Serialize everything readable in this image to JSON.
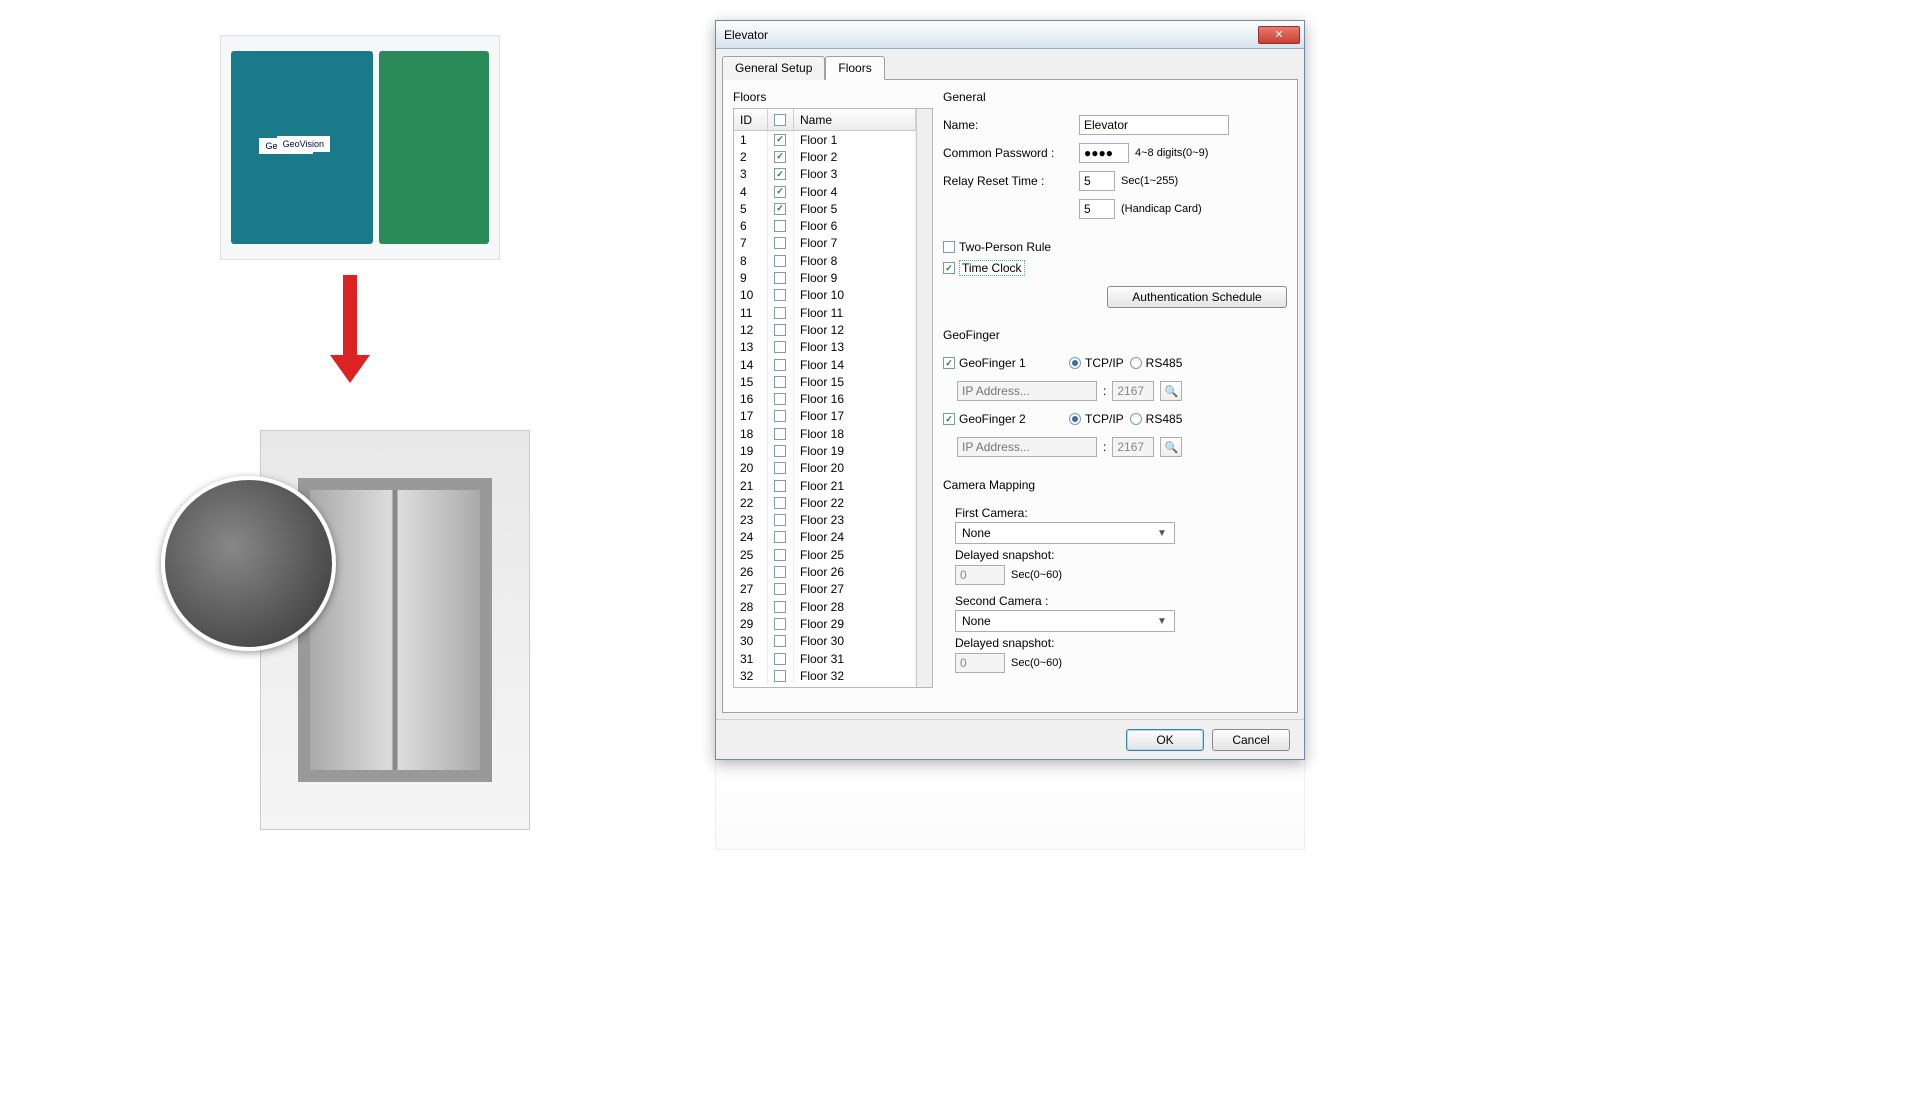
{
  "window": {
    "title": "Elevator",
    "close_glyph": "✕",
    "tabs": {
      "general_setup": "General Setup",
      "floors": "Floors"
    },
    "active_tab": "Floors"
  },
  "floors_panel": {
    "group_label": "Floors",
    "cols": {
      "id": "ID",
      "name": "Name"
    },
    "rows": [
      {
        "id": "1",
        "name": "Floor 1",
        "checked": true
      },
      {
        "id": "2",
        "name": "Floor 2",
        "checked": true
      },
      {
        "id": "3",
        "name": "Floor 3",
        "checked": true
      },
      {
        "id": "4",
        "name": "Floor 4",
        "checked": true
      },
      {
        "id": "5",
        "name": "Floor 5",
        "checked": true
      },
      {
        "id": "6",
        "name": "Floor 6",
        "checked": false
      },
      {
        "id": "7",
        "name": "Floor 7",
        "checked": false
      },
      {
        "id": "8",
        "name": "Floor 8",
        "checked": false
      },
      {
        "id": "9",
        "name": "Floor 9",
        "checked": false
      },
      {
        "id": "10",
        "name": "Floor 10",
        "checked": false
      },
      {
        "id": "11",
        "name": "Floor 11",
        "checked": false
      },
      {
        "id": "12",
        "name": "Floor 12",
        "checked": false
      },
      {
        "id": "13",
        "name": "Floor 13",
        "checked": false
      },
      {
        "id": "14",
        "name": "Floor 14",
        "checked": false
      },
      {
        "id": "15",
        "name": "Floor 15",
        "checked": false
      },
      {
        "id": "16",
        "name": "Floor 16",
        "checked": false
      },
      {
        "id": "17",
        "name": "Floor 17",
        "checked": false
      },
      {
        "id": "18",
        "name": "Floor 18",
        "checked": false
      },
      {
        "id": "19",
        "name": "Floor 19",
        "checked": false
      },
      {
        "id": "20",
        "name": "Floor 20",
        "checked": false
      },
      {
        "id": "21",
        "name": "Floor 21",
        "checked": false
      },
      {
        "id": "22",
        "name": "Floor 22",
        "checked": false
      },
      {
        "id": "23",
        "name": "Floor 23",
        "checked": false
      },
      {
        "id": "24",
        "name": "Floor 24",
        "checked": false
      },
      {
        "id": "25",
        "name": "Floor 25",
        "checked": false
      },
      {
        "id": "26",
        "name": "Floor 26",
        "checked": false
      },
      {
        "id": "27",
        "name": "Floor 27",
        "checked": false
      },
      {
        "id": "28",
        "name": "Floor 28",
        "checked": false
      },
      {
        "id": "29",
        "name": "Floor 29",
        "checked": false
      },
      {
        "id": "30",
        "name": "Floor 30",
        "checked": false
      },
      {
        "id": "31",
        "name": "Floor 31",
        "checked": false
      },
      {
        "id": "32",
        "name": "Floor 32",
        "checked": false
      }
    ]
  },
  "general": {
    "group_label": "General",
    "name_label": "Name:",
    "name_value": "Elevator",
    "password_label": "Common Password :",
    "password_value": "●●●●",
    "password_hint": "4~8 digits(0~9)",
    "relay_label": "Relay Reset Time :",
    "relay_value": "5",
    "relay_unit": "Sec(1~255)",
    "handicap_value": "5",
    "handicap_unit": "(Handicap Card)",
    "two_person_label": "Two-Person Rule",
    "two_person_checked": false,
    "time_clock_label": "Time Clock",
    "time_clock_checked": true,
    "auth_button": "Authentication Schedule"
  },
  "geofinger": {
    "group_label": "GeoFinger",
    "gf1": {
      "label": "GeoFinger 1",
      "checked": true,
      "tcpip": "TCP/IP",
      "rs485": "RS485",
      "mode": "tcpip",
      "ip_placeholder": "IP Address...",
      "port": "2167"
    },
    "gf2": {
      "label": "GeoFinger 2",
      "checked": true,
      "tcpip": "TCP/IP",
      "rs485": "RS485",
      "mode": "tcpip",
      "ip_placeholder": "IP Address...",
      "port": "2167"
    },
    "browse_glyph": "🔍"
  },
  "camera": {
    "group_label": "Camera Mapping",
    "first_label": "First Camera:",
    "first_value": "None",
    "delay_label": "Delayed snapshot:",
    "delay1_value": "0",
    "delay_unit": "Sec(0~60)",
    "second_label": "Second Camera :",
    "second_value": "None",
    "delay2_value": "0"
  },
  "footer": {
    "ok": "OK",
    "cancel": "Cancel"
  }
}
